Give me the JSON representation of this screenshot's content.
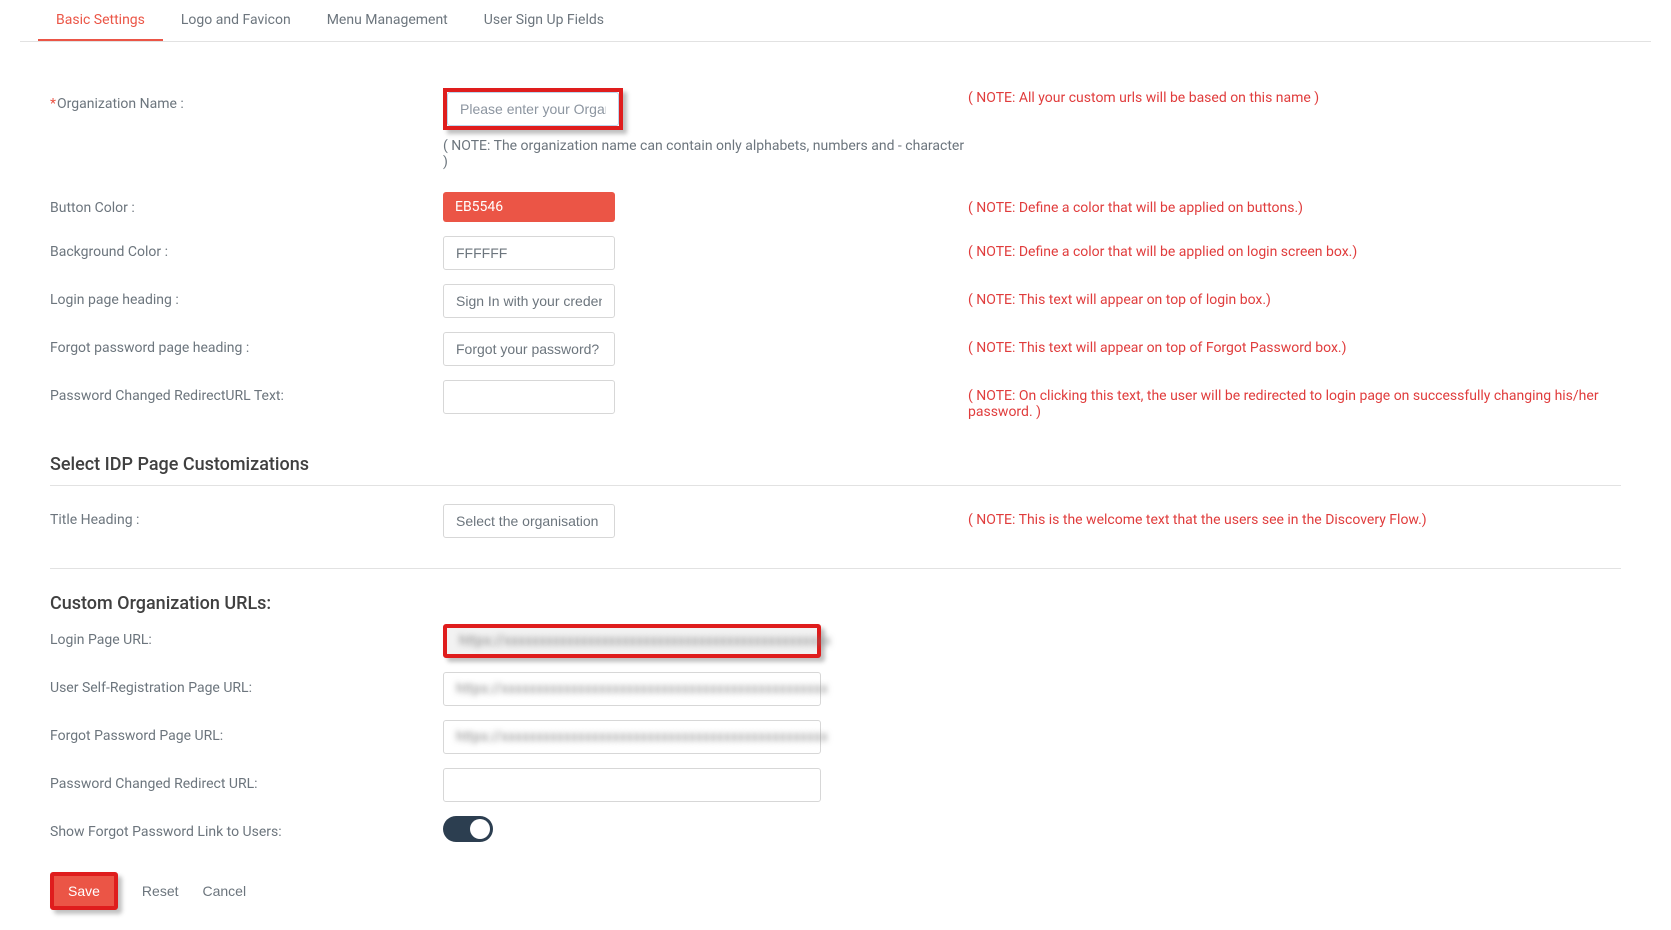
{
  "tabs": {
    "basic": "Basic Settings",
    "logo": "Logo and Favicon",
    "menu": "Menu Management",
    "signup": "User Sign Up Fields"
  },
  "fields": {
    "org_name": {
      "label": "Organization Name :",
      "placeholder": "Please enter your Organi",
      "sub_note": "( NOTE: The organization name can contain only alphabets, numbers and - character )",
      "side_note": "( NOTE: All your custom urls will be based on this name )"
    },
    "button_color": {
      "label": "Button Color :",
      "value": "EB5546",
      "side_note": "( NOTE: Define a color that will be applied on buttons.)"
    },
    "background_color": {
      "label": "Background Color :",
      "value": "FFFFFF",
      "side_note": "( NOTE: Define a color that will be applied on login screen box.)"
    },
    "login_heading": {
      "label": "Login page heading :",
      "value": "Sign In with your credent",
      "side_note": "( NOTE: This text will appear on top of login box.)"
    },
    "forgot_heading": {
      "label": "Forgot password page heading :",
      "value": "Forgot your password?",
      "side_note": "( NOTE: This text will appear on top of Forgot Password box.)"
    },
    "redirect_text": {
      "label": "Password Changed RedirectURL Text:",
      "value": "",
      "side_note": "( NOTE: On clicking this text, the user will be redirected to login page on successfully changing his/her password. )"
    }
  },
  "idp": {
    "heading": "Select IDP Page Customizations",
    "title_heading": {
      "label": "Title Heading :",
      "value": "Select the organisation y",
      "side_note": "( NOTE: This is the welcome text that the users see in the Discovery Flow.)"
    }
  },
  "urls": {
    "heading": "Custom Organization URLs:",
    "login": {
      "label": "Login Page URL:",
      "value": "https://xxxxxxxxxxxxxxxxxxxxxxxxxxxxxxxxxxxxxxxxxxxxxxx"
    },
    "self_reg": {
      "label": "User Self-Registration Page URL:",
      "value": "https://xxxxxxxxxxxxxxxxxxxxxxxxxxxxxxxxxxxxxxxxxxxxxxx"
    },
    "forgot": {
      "label": "Forgot Password Page URL:",
      "value": "https://xxxxxxxxxxxxxxxxxxxxxxxxxxxxxxxxxxxxxxxxxxxxxxx"
    },
    "pwd_redirect": {
      "label": "Password Changed Redirect URL:",
      "value": ""
    },
    "show_forgot": {
      "label": "Show Forgot Password Link to Users:"
    }
  },
  "actions": {
    "save": "Save",
    "reset": "Reset",
    "cancel": "Cancel"
  }
}
